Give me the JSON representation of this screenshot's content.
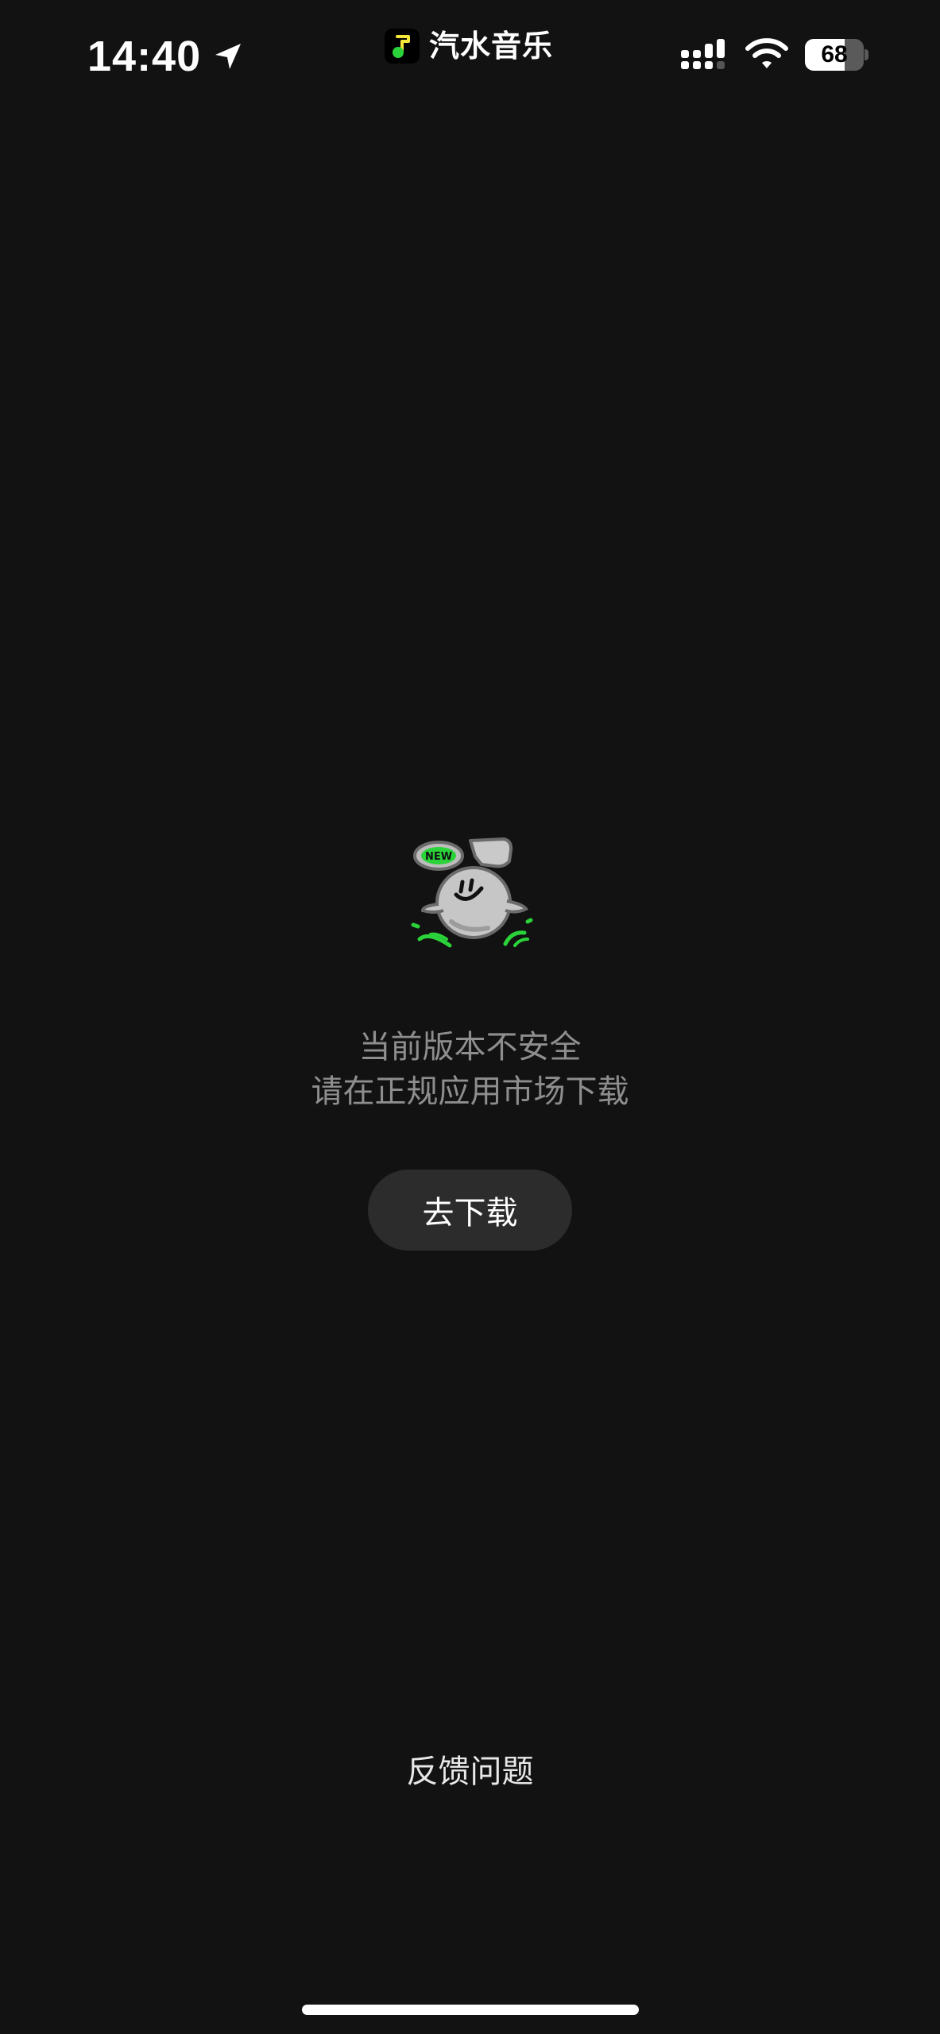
{
  "status_bar": {
    "time": "14:40",
    "location_icon": "location-arrow-icon",
    "app_name": "汽水音乐",
    "app_logo_icon": "soda-music-logo-icon",
    "signal_icon": "cellular-signal-icon",
    "wifi_icon": "wifi-icon",
    "battery_level": "68",
    "battery_fraction": 0.68
  },
  "main": {
    "illustration": "mascot-illustration",
    "illustration_badge": "NEW",
    "message_line1": "当前版本不安全",
    "message_line2": "请在正规应用市场下载",
    "download_label": "去下载",
    "feedback_label": "反馈问题"
  },
  "colors": {
    "background": "#121212",
    "message_text": "#8e8e8e",
    "button_bg": "#2c2c2c",
    "accent_green": "#2bd33a"
  }
}
